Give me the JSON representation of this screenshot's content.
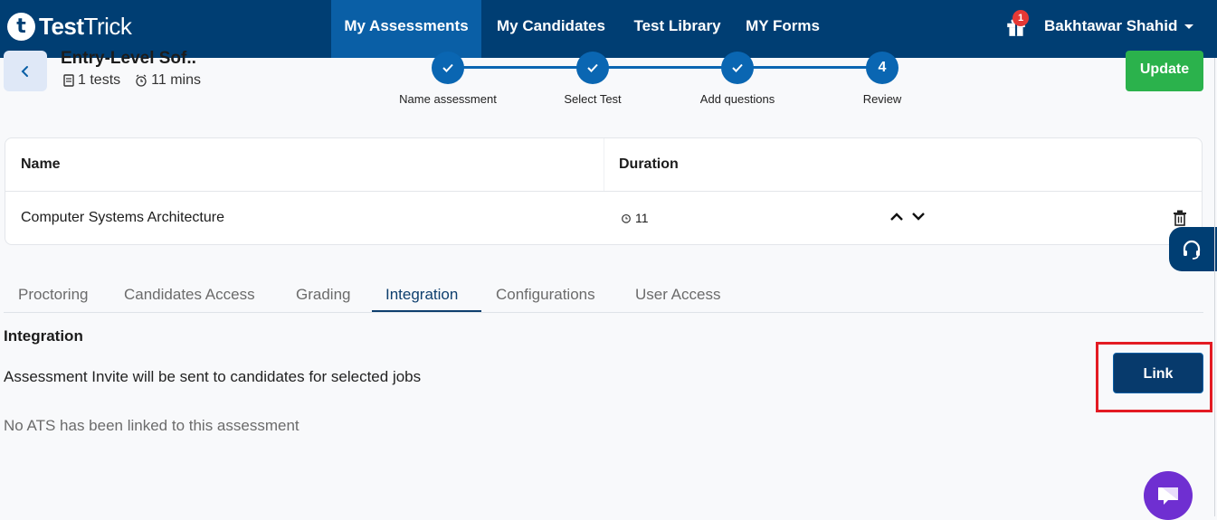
{
  "brand": {
    "logo_letter": "t",
    "name_bold": "Test",
    "name_regular": "Trick"
  },
  "nav": {
    "items": [
      {
        "label": "My Assessments",
        "active": true
      },
      {
        "label": "My Candidates",
        "active": false
      },
      {
        "label": "Test Library",
        "active": false
      },
      {
        "label": "MY Forms",
        "active": false
      }
    ],
    "gift_badge": "1",
    "user_name": "Bakhtawar Shahid"
  },
  "assessment": {
    "title": "Entry-Level Sof..",
    "tests_count": "1 tests",
    "duration": "11 mins"
  },
  "stepper": {
    "steps": [
      {
        "label": "Name assessment",
        "state": "done",
        "number": ""
      },
      {
        "label": "Select Test",
        "state": "done",
        "number": ""
      },
      {
        "label": "Add questions",
        "state": "done",
        "number": ""
      },
      {
        "label": "Review",
        "state": "current",
        "number": "4"
      }
    ]
  },
  "actions": {
    "update_label": "Update",
    "link_label": "Link"
  },
  "table": {
    "headers": {
      "name": "Name",
      "duration": "Duration"
    },
    "rows": [
      {
        "name": "Computer Systems Architecture",
        "duration": "11"
      }
    ]
  },
  "tabs": [
    {
      "label": "Proctoring",
      "active": false
    },
    {
      "label": "Candidates Access",
      "active": false
    },
    {
      "label": "Grading",
      "active": false
    },
    {
      "label": "Integration",
      "active": true
    },
    {
      "label": "Configurations",
      "active": false
    },
    {
      "label": "User Access",
      "active": false
    }
  ],
  "integration": {
    "title": "Integration",
    "description": "Assessment Invite will be sent to candidates for selected jobs",
    "empty_state": "No ATS has been linked to this assessment"
  },
  "colors": {
    "navbar": "#003e73",
    "nav_active": "#0a5fa6",
    "stepper": "#0a66b2",
    "update_button": "#2bb24c",
    "link_button": "#073a6c",
    "highlight": "#e31b23",
    "chat_button": "#6f2fd1"
  },
  "icons": [
    "gift-icon",
    "chevron-left-icon",
    "document-icon",
    "alarm-clock-icon",
    "check-icon",
    "chevron-up-icon",
    "chevron-down-icon",
    "trash-icon",
    "headset-icon",
    "chat-bubble-icon"
  ]
}
